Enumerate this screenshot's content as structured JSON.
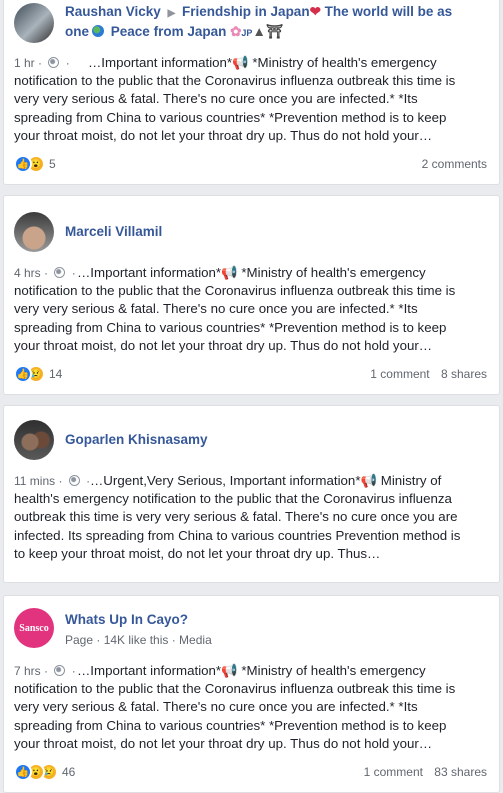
{
  "posts": [
    {
      "header_line1_name": "Raushan Vicky",
      "header_line1_group": "Friendship in Japan",
      "header_line1_rest": "The world will be as",
      "header_line2": "one",
      "header_line2_rest": "Peace from Japan",
      "header_line2_tail": "JP",
      "time": "1 hr",
      "text": "…Important information*📢 *Ministry of health's emergency notification to the public that the Coronavirus influenza outbreak this time is very very serious & fatal. There's no cure once you are infected.* *Its spreading from China to various countries* *Prevention method is to keep your throat moist, do not let your throat dry up. Thus do not hold your…",
      "reaction_count": "5",
      "comments": "2 comments",
      "shares": ""
    },
    {
      "name": "Marceli Villamil",
      "time": "4 hrs",
      "text": "…Important information*📢 *Ministry of health's emergency notification to the public that the Coronavirus influenza outbreak this time is very very serious & fatal. There's no cure once you are infected.* *Its spreading from China to various countries* *Prevention method is to keep your throat moist, do not let your throat dry up. Thus do not hold your…",
      "reaction_count": "14",
      "comments": "1 comment",
      "shares": "8 shares"
    },
    {
      "name": "Goparlen Khisnasamy",
      "time": "11 mins",
      "text": "…Urgent,Very Serious, Important information*📢 Ministry of health's emergency notification to the public that the Coronavirus influenza outbreak this time is very very serious & fatal. There's no cure once you are infected. Its spreading from China to various countries Prevention method is to keep your throat moist, do not let your throat dry up. Thus…",
      "reaction_count": "",
      "comments": "",
      "shares": ""
    },
    {
      "name": "Whats Up In Cayo?",
      "subtitle": "Page · 14K like this · Media",
      "logo_text": "Sansco",
      "time": "7 hrs",
      "text": "…Important information*📢 *Ministry of health's emergency notification to the public that the Coronavirus influenza outbreak this time is very very serious & fatal. There's no cure once you are infected.* *Its spreading from China to various countries* *Prevention method is to keep your throat moist, do not let your throat dry up. Thus do not hold your…",
      "reaction_count": "46",
      "comments": "1 comment",
      "shares": "83 shares"
    }
  ],
  "colors": {
    "link": "#365899",
    "like_blue": "#2078f4",
    "wow_yellow": "#f7b125",
    "bg": "#e9ebee"
  }
}
